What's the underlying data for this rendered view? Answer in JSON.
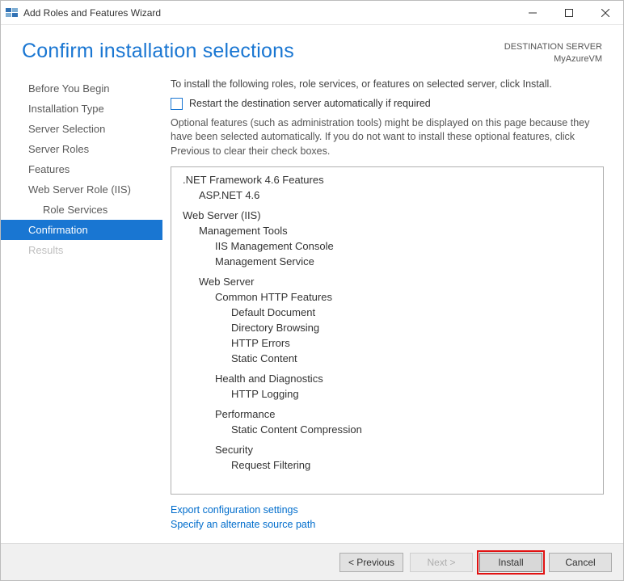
{
  "window": {
    "title": "Add Roles and Features Wizard"
  },
  "header": {
    "page_title": "Confirm installation selections",
    "destination_label": "DESTINATION SERVER",
    "destination_value": "MyAzureVM"
  },
  "nav": {
    "items": [
      {
        "label": "Before You Begin",
        "state": "normal"
      },
      {
        "label": "Installation Type",
        "state": "normal"
      },
      {
        "label": "Server Selection",
        "state": "normal"
      },
      {
        "label": "Server Roles",
        "state": "normal"
      },
      {
        "label": "Features",
        "state": "normal"
      },
      {
        "label": "Web Server Role (IIS)",
        "state": "normal"
      },
      {
        "label": "Role Services",
        "state": "normal",
        "indent": true
      },
      {
        "label": "Confirmation",
        "state": "selected"
      },
      {
        "label": "Results",
        "state": "disabled"
      }
    ]
  },
  "main": {
    "intro": "To install the following roles, role services, or features on selected server, click Install.",
    "restart_checkbox_label": "Restart the destination server automatically if required",
    "note": "Optional features (such as administration tools) might be displayed on this page because they have been selected automatically. If you do not want to install these optional features, click Previous to clear their check boxes.",
    "tree": [
      {
        "level": 0,
        "label": ".NET Framework 4.6 Features"
      },
      {
        "level": 1,
        "label": "ASP.NET 4.6"
      },
      {
        "level": 0,
        "label": "Web Server (IIS)",
        "space": true
      },
      {
        "level": 1,
        "label": "Management Tools"
      },
      {
        "level": 2,
        "label": "IIS Management Console"
      },
      {
        "level": 2,
        "label": "Management Service"
      },
      {
        "level": 1,
        "label": "Web Server",
        "space": true
      },
      {
        "level": 2,
        "label": "Common HTTP Features"
      },
      {
        "level": 3,
        "label": "Default Document"
      },
      {
        "level": 3,
        "label": "Directory Browsing"
      },
      {
        "level": 3,
        "label": "HTTP Errors"
      },
      {
        "level": 3,
        "label": "Static Content"
      },
      {
        "level": 2,
        "label": "Health and Diagnostics",
        "space": true
      },
      {
        "level": 3,
        "label": "HTTP Logging"
      },
      {
        "level": 2,
        "label": "Performance",
        "space": true
      },
      {
        "level": 3,
        "label": "Static Content Compression"
      },
      {
        "level": 2,
        "label": "Security",
        "space": true
      },
      {
        "level": 3,
        "label": "Request Filtering"
      }
    ],
    "links": {
      "export": "Export configuration settings",
      "alt_source": "Specify an alternate source path"
    }
  },
  "footer": {
    "previous": "< Previous",
    "next": "Next >",
    "install": "Install",
    "cancel": "Cancel"
  }
}
